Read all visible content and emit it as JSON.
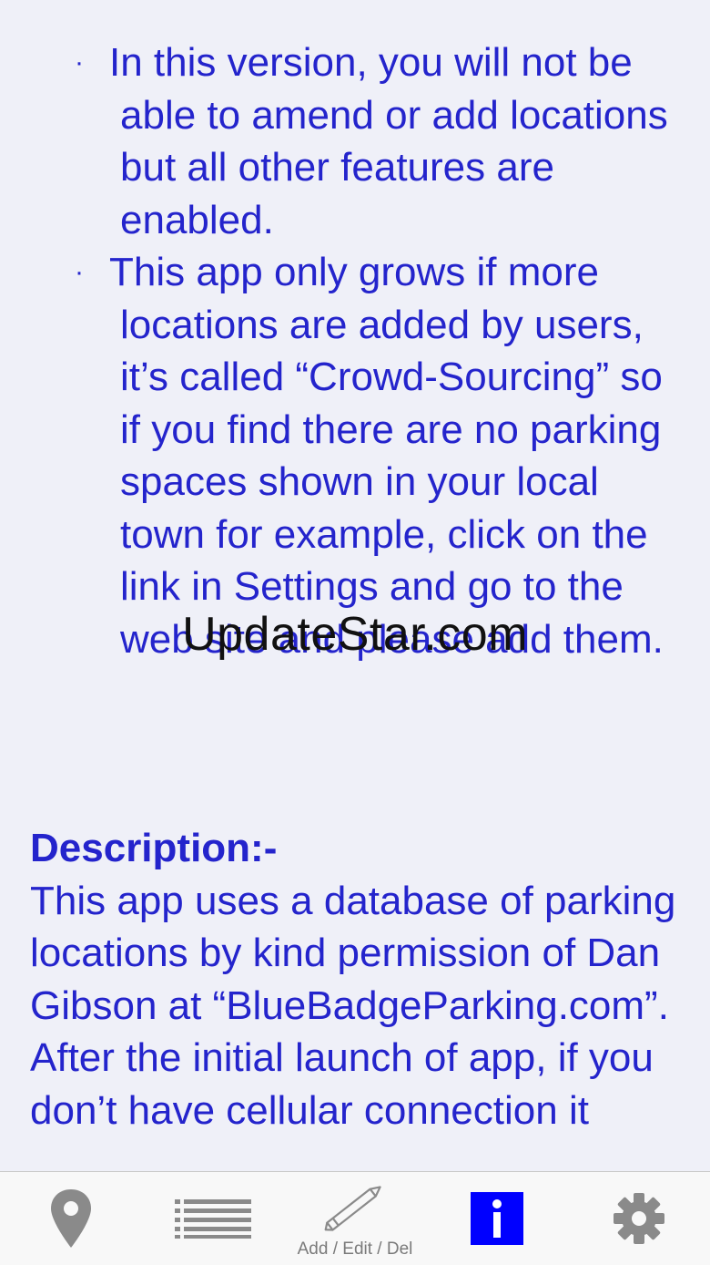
{
  "info_page": {
    "bullets": [
      "In this version, you will not be able to amend or add locations but all other features are enabled.",
      "This app only grows if more locations are added by users, it’s called “Crowd-Sourcing” so if you find there are no parking spaces shown in your local town for example, click on the link in Settings and go to the web site and please add them."
    ],
    "bullet_symbol": "·",
    "description_heading": "Description:-",
    "description_text": "This app uses a database of parking locations by kind permission of Dan Gibson at “BlueBadgeParking.com”. After the initial launch of app, if you don’t have cellular connection it"
  },
  "watermark": "UpdateStar.com",
  "tabbar": {
    "tabs": [
      {
        "icon": "map-pin-icon",
        "label": ""
      },
      {
        "icon": "list-icon",
        "label": ""
      },
      {
        "icon": "pencil-icon",
        "label": "Add / Edit / Del"
      },
      {
        "icon": "info-icon",
        "label": "",
        "selected": true
      },
      {
        "icon": "gear-icon",
        "label": ""
      }
    ]
  },
  "colors": {
    "text": "#2424cc",
    "background": "#eff0f8",
    "tab_active": "#0000ff",
    "tab_inactive": "#8a8a8a"
  }
}
